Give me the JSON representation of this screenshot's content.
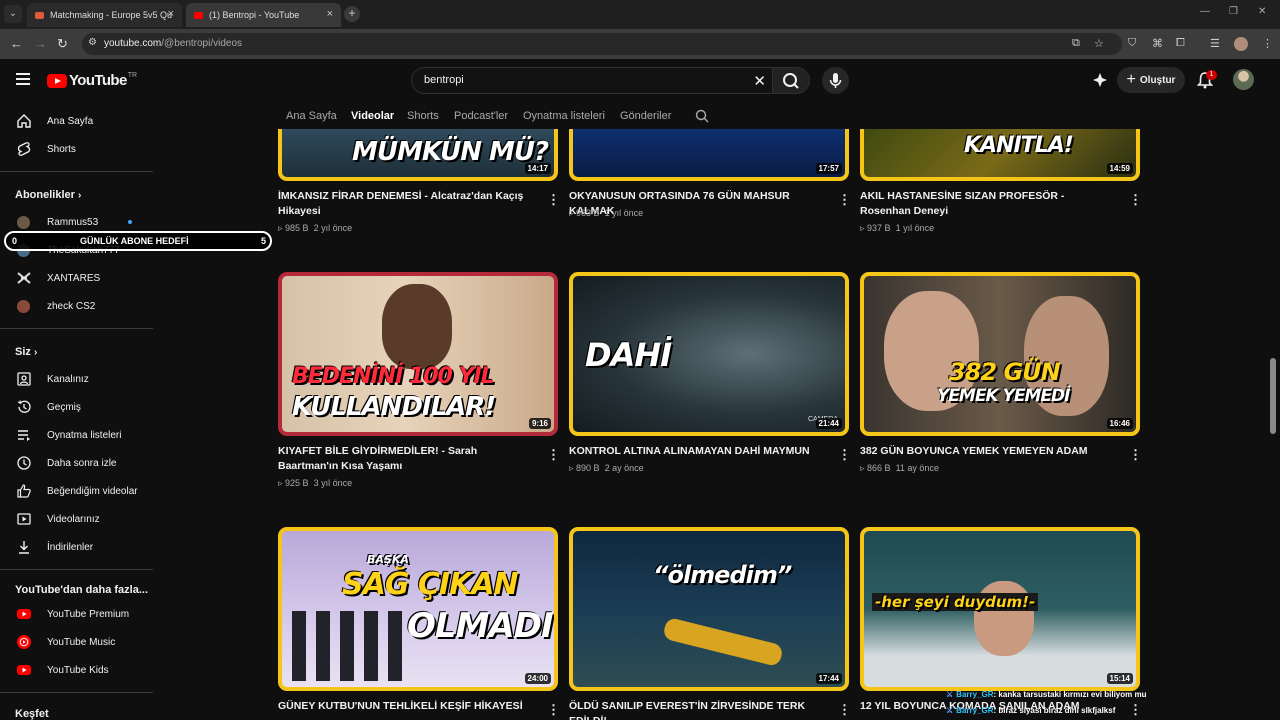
{
  "browser": {
    "tabs": [
      {
        "title": "Matchmaking - Europe 5v5 Qu",
        "favicon_color": "#e05a3a"
      },
      {
        "title": "(1) Bentropi - YouTube",
        "favicon_color": "#ff0000"
      }
    ],
    "url_host": "youtube.com",
    "url_path": "/@bentropi/videos"
  },
  "header": {
    "logo_text": "YouTube",
    "logo_region": "TR",
    "search_value": "bentropi",
    "create_label": "Oluştur",
    "notification_count": "1"
  },
  "sidebar": {
    "main": [
      {
        "label": "Ana Sayfa",
        "icon": "home-icon"
      },
      {
        "label": "Shorts",
        "icon": "shorts-icon"
      }
    ],
    "subscriptions_title": "Abonelikler",
    "subscriptions": [
      {
        "label": "Rammus53",
        "avatar_color": "#6b5a48",
        "live": true
      },
      {
        "label": "TheSakultah777",
        "avatar_color": "#4a6d8a",
        "live": false
      },
      {
        "label": "XANTARES",
        "avatar_color": "#dddddd",
        "live": false
      },
      {
        "label": "zheck CS2",
        "avatar_color": "#8a4a3a",
        "live": false
      }
    ],
    "you_title": "Siz",
    "you_items": [
      {
        "label": "Kanalınız",
        "icon": "channel-icon"
      },
      {
        "label": "Geçmiş",
        "icon": "history-icon"
      },
      {
        "label": "Oynatma listeleri",
        "icon": "playlists-icon"
      },
      {
        "label": "Daha sonra izle",
        "icon": "watch-later-icon"
      },
      {
        "label": "Beğendiğim videolar",
        "icon": "like-icon"
      },
      {
        "label": "Videolarınız",
        "icon": "your-videos-icon"
      },
      {
        "label": "İndirilenler",
        "icon": "download-icon"
      }
    ],
    "more_title": "YouTube'dan daha fazla...",
    "more_items": [
      {
        "label": "YouTube Premium",
        "color": "#ff0000"
      },
      {
        "label": "YouTube Music",
        "color": "#ff0000"
      },
      {
        "label": "YouTube Kids",
        "color": "#ff0000"
      }
    ],
    "explore_title": "Keşfet"
  },
  "goal_overlay": {
    "left": "0",
    "label": "GÜNLÜK ABONE HEDEFİ",
    "right": "5"
  },
  "channel_tabs": [
    "Ana Sayfa",
    "Videolar",
    "Shorts",
    "Podcast'ler",
    "Oynatma listeleri",
    "Gönderiler"
  ],
  "active_tab": "Videolar",
  "videos": [
    {
      "title": "İMKANSIZ FİRAR DENEMESİ - Alcatraz'dan Kaçış Hikayesi",
      "views": "985 B",
      "age": "2 yıl önce",
      "duration": "14:17",
      "overlay": "MÜMKÜN MÜ?"
    },
    {
      "title": "OKYANUSUN ORTASINDA 76 GÜN MAHSUR KALMAK",
      "views": "963 B",
      "age": "1 yıl önce",
      "duration": "17:57",
      "overlay": ""
    },
    {
      "title": "AKIL HASTANESİNE SIZAN PROFESÖR - Rosenhan Deneyi",
      "views": "937 B",
      "age": "1 yıl önce",
      "duration": "14:59",
      "overlay": "KANITLA!"
    },
    {
      "title": "KIYAFET BİLE GİYDİRMEDİLER! - Sarah Baartman'ın Kısa Yaşamı",
      "views": "925 B",
      "age": "3 yıl önce",
      "duration": "9:16",
      "overlay": "BEDENİNİ 100 YIL",
      "overlay2": "KULLANDILAR!"
    },
    {
      "title": "KONTROL ALTINA ALINAMAYAN DAHİ MAYMUN",
      "views": "890 B",
      "age": "2 ay önce",
      "duration": "21:44",
      "overlay": "DAHİ",
      "overlay2": "CAMERA"
    },
    {
      "title": "382 GÜN BOYUNCA YEMEK YEMEYEN ADAM",
      "views": "866 B",
      "age": "11 ay önce",
      "duration": "16:46",
      "overlay": "382 GÜN",
      "overlay2": "YEMEK YEMEDİ"
    },
    {
      "title": "GÜNEY KUTBU'NUN TEHLİKELİ KEŞİF HİKAYESİ",
      "views": "",
      "age": "",
      "duration": "24:00",
      "overlay": "BAŞKA",
      "overlay2": "SAĞ ÇIKAN",
      "overlay3": "OLMADI"
    },
    {
      "title": "ÖLDÜ SANILIP EVEREST'İN ZİRVESİNDE TERK EDİLDİ!",
      "views": "",
      "age": "",
      "duration": "17:44",
      "overlay": "“ölmedim”"
    },
    {
      "title": "12 YIL BOYUNCA KOMADA SANILAN ADAM",
      "views": "",
      "age": "",
      "duration": "15:14",
      "overlay": "-her şeyi duydum!-"
    }
  ],
  "chat": [
    {
      "user": "Barry_GR",
      "message": ": kanka tarsustaki kırmızı evi biliyom mu"
    },
    {
      "user": "Barry_GR",
      "message": ": biraz siyasi biraz dini slkfjalksf"
    }
  ]
}
